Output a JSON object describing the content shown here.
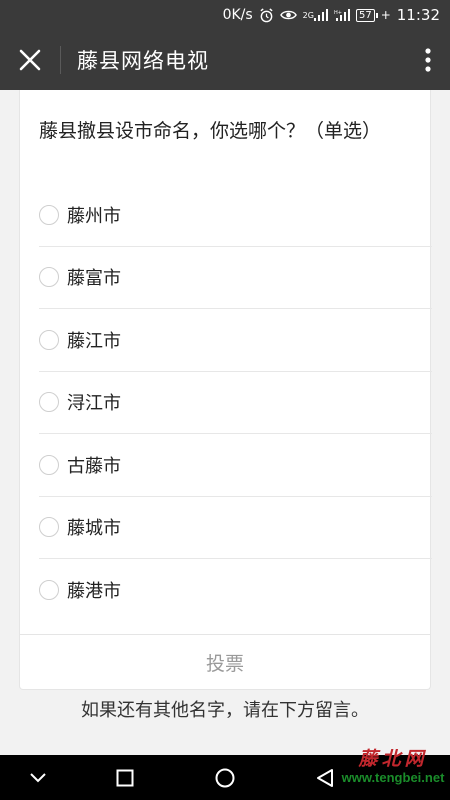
{
  "status_bar": {
    "net_speed": "0K/s",
    "net_type": "2G",
    "battery": "57",
    "time": "11:32"
  },
  "header": {
    "title": "藤县网络电视"
  },
  "poll": {
    "question": "藤县撤县设市命名，你选哪个？（单选）",
    "options": [
      "藤州市",
      "藤富市",
      "藤江市",
      "浔江市",
      "古藤市",
      "藤城市",
      "藤港市"
    ],
    "submit_label": "投票"
  },
  "footnote": "如果还有其他名字，请在下方留言。",
  "watermark": {
    "logo": "藤北网",
    "url": "www.tengbei.net"
  },
  "colors": {
    "header_bg": "#3a3a3a",
    "page_bg": "#f2f2f2",
    "watermark_red": "#c1272d",
    "watermark_green": "#1a8c2a"
  }
}
